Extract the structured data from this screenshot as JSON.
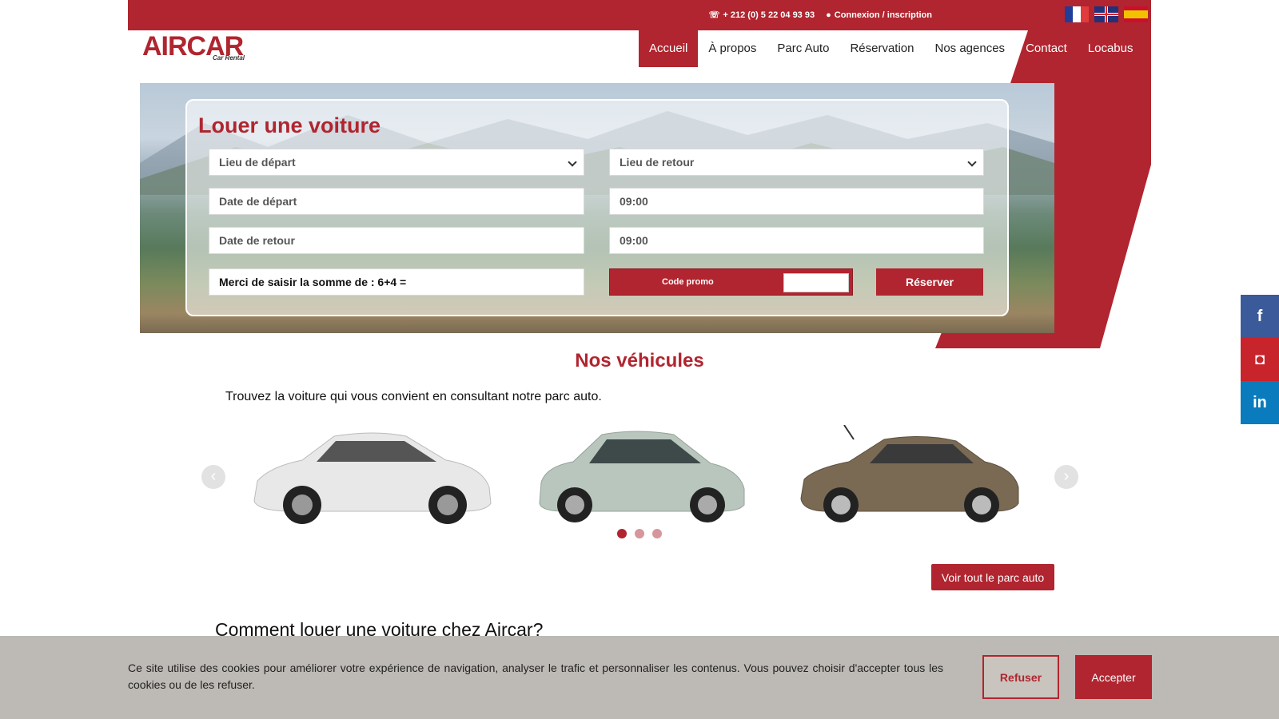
{
  "topbar": {
    "phone": "+ 212 (0) 5 22 04 93 93",
    "login": "Connexion / inscription",
    "languages": [
      "Français",
      "English",
      "Español"
    ]
  },
  "logo": {
    "name": "AIRCAR",
    "tagline": "Car Rental"
  },
  "nav": {
    "items": [
      "Accueil",
      "À propos",
      "Parc Auto",
      "Réservation",
      "Nos agences",
      "Contact",
      "Locabus"
    ],
    "active": "Accueil"
  },
  "booking": {
    "title": "Louer une voiture",
    "pickup_location": "Lieu de départ",
    "return_location": "Lieu de retour",
    "pickup_date": "Date de départ",
    "pickup_time": "09:00",
    "return_date": "Date de retour",
    "return_time": "09:00",
    "captcha": "Merci de saisir la somme de : 6+4 =",
    "promo_label": "Code promo",
    "reserve_button": "Réserver"
  },
  "vehicles": {
    "title": "Nos véhicules",
    "subtitle": "Trouvez la voiture qui vous convient en consultant notre parc auto.",
    "prev": "‹",
    "next": "›",
    "cars": [
      {
        "color": "#e8e8e8",
        "icon": "white-hatchback"
      },
      {
        "color": "#b9c6be",
        "icon": "mint-city-car"
      },
      {
        "color": "#7a6a54",
        "icon": "bronze-sedan"
      }
    ],
    "active_dot": 0,
    "dot_count": 3,
    "fleet_button": "Voir tout le parc auto"
  },
  "how": {
    "title": "Comment louer une voiture chez Aircar?"
  },
  "social": {
    "facebook": "f",
    "instagram": "◘",
    "linkedin": "in"
  },
  "cookie": {
    "text": "Ce site utilise des cookies pour améliorer votre expérience de navigation, analyser le trafic et personnaliser les contenus. Vous pouvez choisir d'accepter tous les cookies ou de les refuser.",
    "refuse": "Refuser",
    "accept": "Accepter"
  },
  "colors": {
    "brand": "#b0252f"
  }
}
